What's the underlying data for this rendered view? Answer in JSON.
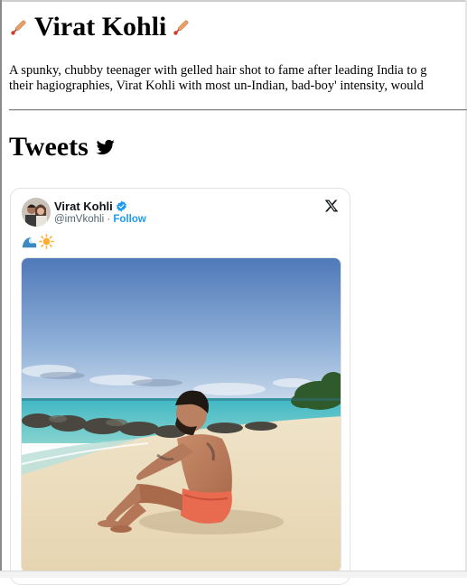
{
  "page": {
    "title": "Virat Kohli",
    "bio_line1": "A spunky, chubby teenager with gelled hair shot to fame after leading India to g",
    "bio_line2": "their hagiographies, Virat Kohli with most un-Indian, bad-boy' intensity, would",
    "section_heading": "Tweets"
  },
  "icons": {
    "title_left": "cricket-bat-icon",
    "title_right": "cricket-bat-icon",
    "section": "twitter-bird-icon"
  },
  "tweet": {
    "author_name": "Virat Kohli",
    "author_handle": "@imVkohli",
    "separator": "·",
    "follow_label": "Follow",
    "verified": true,
    "text_emojis": [
      "water-wave-emoji",
      "sun-emoji"
    ],
    "brand_icon": "x-logo-icon",
    "media": "beach-photo"
  },
  "colors": {
    "link_blue": "#1d9bf0",
    "muted_text": "#536471",
    "verified_blue": "#1d9bf0"
  }
}
